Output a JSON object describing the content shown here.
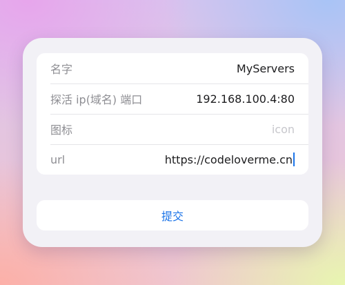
{
  "form": {
    "fields": [
      {
        "label": "名字",
        "value": "MyServers",
        "placeholder": ""
      },
      {
        "label": "探活 ip(域名) 端口",
        "value": "192.168.100.4:80",
        "placeholder": ""
      },
      {
        "label": "图标",
        "value": "",
        "placeholder": "icon"
      },
      {
        "label": "url",
        "value": "https://codeloverme.cn",
        "placeholder": ""
      }
    ]
  },
  "actions": {
    "submit_label": "提交"
  },
  "colors": {
    "accent": "#1a73e8",
    "label": "#8e8e93",
    "placeholder": "#c7c7cc",
    "card_background": "#f2f1f6"
  }
}
